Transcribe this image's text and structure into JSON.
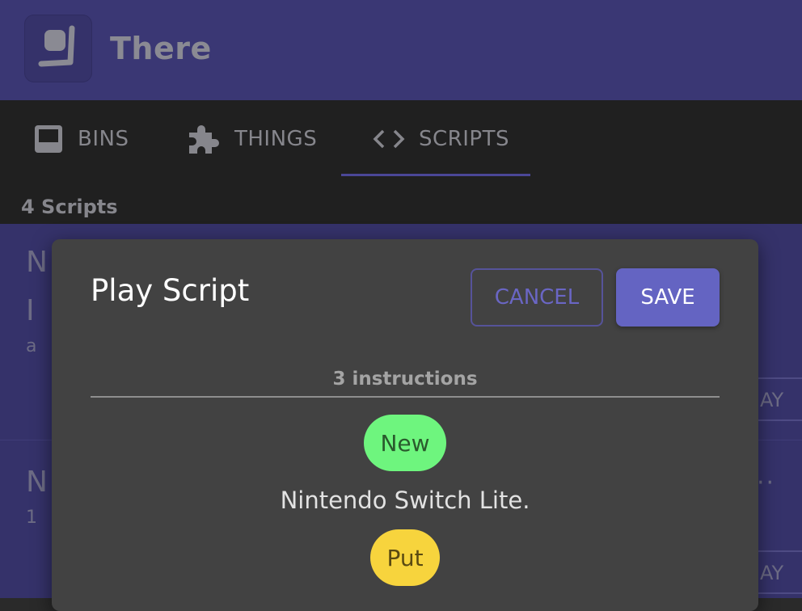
{
  "app": {
    "title": "There",
    "logo_icon": "there-logo-icon"
  },
  "tabs": [
    {
      "label": "BINS",
      "icon": "inbox-icon",
      "active": false
    },
    {
      "label": "THINGS",
      "icon": "puzzle-icon",
      "active": false
    },
    {
      "label": "SCRIPTS",
      "icon": "code-icon",
      "active": true
    }
  ],
  "list": {
    "count_label": "4 Scripts"
  },
  "modal": {
    "title": "Play Script",
    "cancel_label": "CANCEL",
    "save_label": "SAVE",
    "instruction_count": "3 instructions",
    "instructions": [
      {
        "kind": "New",
        "color": "#6ef57e",
        "text_color": "#2a5a2d"
      },
      {
        "text": "Nintendo Switch Lite."
      },
      {
        "kind": "Put",
        "color": "#f7d43d",
        "text_color": "#5a4a12"
      }
    ]
  },
  "colors": {
    "header": "#3a3774",
    "tabbar": "#202020",
    "modal": "#424242",
    "accent": "#6464c2"
  }
}
